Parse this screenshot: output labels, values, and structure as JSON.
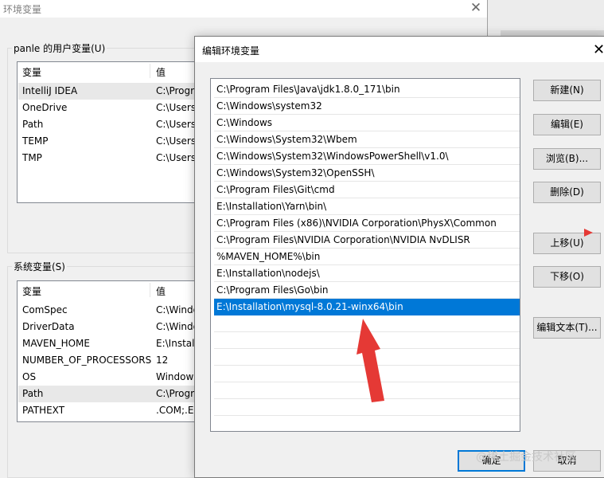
{
  "background_window": {
    "title": "环境变量",
    "close_glyph": "✕",
    "user_group": {
      "label": "panle 的用户变量(U)",
      "col_variable": "变量",
      "col_value": "值",
      "rows": [
        {
          "name": "IntelliJ IDEA",
          "value": "C:\\Progr"
        },
        {
          "name": "OneDrive",
          "value": "C:\\Users"
        },
        {
          "name": "Path",
          "value": "C:\\Users"
        },
        {
          "name": "TEMP",
          "value": "C:\\Users"
        },
        {
          "name": "TMP",
          "value": "C:\\Users"
        }
      ]
    },
    "system_group": {
      "label": "系统变量(S)",
      "col_variable": "变量",
      "col_value": "值",
      "rows": [
        {
          "name": "ComSpec",
          "value": "C:\\Windo"
        },
        {
          "name": "DriverData",
          "value": "C:\\Windo"
        },
        {
          "name": "MAVEN_HOME",
          "value": "E:\\Install"
        },
        {
          "name": "NUMBER_OF_PROCESSORS",
          "value": "12"
        },
        {
          "name": "OS",
          "value": "Window"
        },
        {
          "name": "Path",
          "value": "C:\\Progr"
        },
        {
          "name": "PATHEXT",
          "value": ".COM;.E"
        }
      ]
    }
  },
  "dialog": {
    "title": "编辑环境变量",
    "close_glyph": "✕",
    "paths": [
      "C:\\Program Files\\Java\\jdk1.8.0_171\\bin",
      "C:\\Windows\\system32",
      "C:\\Windows",
      "C:\\Windows\\System32\\Wbem",
      "C:\\Windows\\System32\\WindowsPowerShell\\v1.0\\",
      "C:\\Windows\\System32\\OpenSSH\\",
      "C:\\Program Files\\Git\\cmd",
      "E:\\Installation\\Yarn\\bin\\",
      "C:\\Program Files (x86)\\NVIDIA Corporation\\PhysX\\Common",
      "C:\\Program Files\\NVIDIA Corporation\\NVIDIA NvDLISR",
      "%MAVEN_HOME%\\bin",
      "E:\\Installation\\nodejs\\",
      "C:\\Program Files\\Go\\bin",
      "E:\\Installation\\mysql-8.0.21-winx64\\bin"
    ],
    "selected_index": 13,
    "buttons": {
      "new": "新建(N)",
      "edit": "编辑(E)",
      "browse": "浏览(B)...",
      "delete": "删除(D)",
      "move_up": "上移(U)",
      "move_down": "下移(O)",
      "edit_text": "编辑文本(T)...",
      "ok": "确定",
      "cancel": "取消"
    }
  },
  "watermark": "@稀土掘金技术社区",
  "colors": {
    "selection": "#0078d7",
    "annotation_arrow": "#e53935"
  }
}
